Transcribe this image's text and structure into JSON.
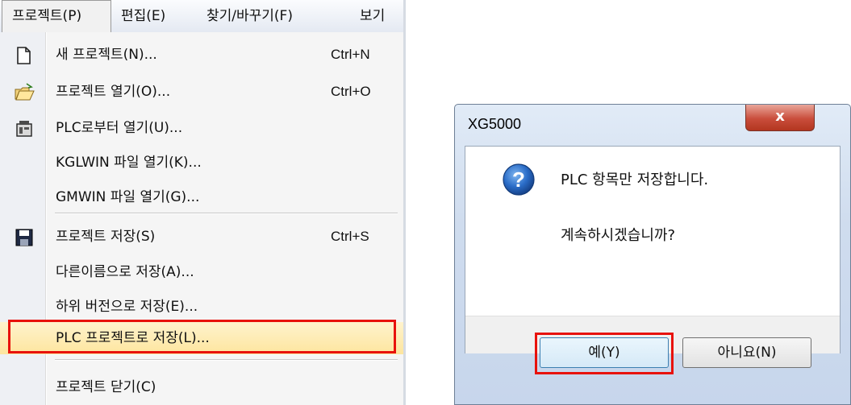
{
  "menubar": {
    "items": [
      {
        "label": "프로젝트(P)"
      },
      {
        "label": "편집(E)"
      },
      {
        "label": "찾기/바꾸기(F)"
      },
      {
        "label": "보기"
      }
    ]
  },
  "menu": {
    "items": [
      {
        "label": "새 프로젝트(N)...",
        "shortcut": "Ctrl+N",
        "icon": "new-document-icon"
      },
      {
        "label": "프로젝트 열기(O)...",
        "shortcut": "Ctrl+O",
        "icon": "open-folder-icon"
      },
      {
        "label": "PLC로부터 열기(U)...",
        "shortcut": "",
        "icon": "plc-device-icon"
      },
      {
        "label": "KGLWIN 파일 열기(K)...",
        "shortcut": ""
      },
      {
        "label": "GMWIN 파일 열기(G)...",
        "shortcut": ""
      },
      {
        "label": "프로젝트 저장(S)",
        "shortcut": "Ctrl+S",
        "icon": "floppy-save-icon"
      },
      {
        "label": "다른이름으로 저장(A)...",
        "shortcut": ""
      },
      {
        "label": "하위 버전으로 저장(E)...",
        "shortcut": ""
      },
      {
        "label": "PLC 프로젝트로 저장(L)...",
        "shortcut": "",
        "highlighted": true
      },
      {
        "label": "프로젝트 닫기(C)",
        "shortcut": ""
      }
    ]
  },
  "dialog": {
    "title": "XG5000",
    "close_label": "x",
    "message_line1": "PLC 항목만 저장합니다.",
    "message_line2": "계속하시겠습니까?",
    "icon": "question-icon",
    "yes_label": "예(Y)",
    "no_label": "아니요(N)"
  },
  "colors": {
    "highlight_box": "#e8120c",
    "menu_highlight": "#fde59e",
    "dialog_frame": "#cfdcee"
  }
}
